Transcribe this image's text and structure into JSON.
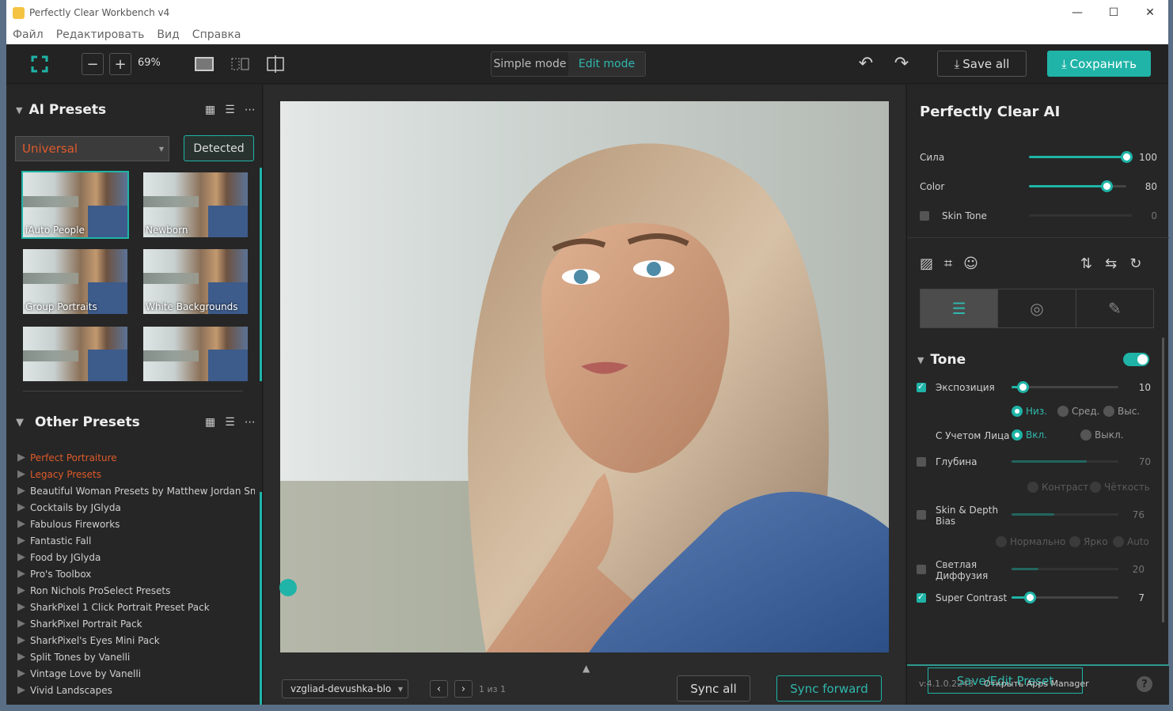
{
  "window": {
    "title": "Perfectly Clear Workbench v4",
    "minimize": "—",
    "maximize": "☐",
    "close": "✕"
  },
  "menu": [
    "Файл",
    "Редактировать",
    "Вид",
    "Справка"
  ],
  "toolbar": {
    "zoom_out": "−",
    "zoom_in": "+",
    "zoom_level": "69%",
    "simple_mode": "Simple mode",
    "edit_mode": "Edit mode",
    "save_all": "Save all",
    "save": "Сохранить",
    "undo_icon": "↶",
    "redo_icon": "↷"
  },
  "ai_presets": {
    "title": "AI Presets",
    "dropdown": "Universal",
    "detected": "Detected",
    "items": [
      "iAuto People",
      "Newborn",
      "Group Portraits",
      "White Backgrounds",
      "",
      ""
    ],
    "selected": "iAuto People"
  },
  "other_presets": {
    "title": "Other Presets",
    "items": [
      "Perfect Portraiture",
      "Legacy Presets",
      "Beautiful Woman Presets by Matthew Jordan Sm...",
      "Cocktails by JGlyda",
      "Fabulous Fireworks",
      "Fantastic Fall",
      "Food by JGlyda",
      "Pro's Toolbox",
      "Ron Nichols ProSelect Presets",
      "SharkPixel 1 Click Portrait Preset Pack",
      "SharkPixel Portrait Pack",
      "SharkPixel's Eyes Mini Pack",
      "Split Tones by Vanelli",
      "Vintage Love by Vanelli",
      "Vivid Landscapes"
    ],
    "highlighted": [
      "Perfect Portraiture",
      "Legacy Presets"
    ]
  },
  "canvas": {
    "filename": "vzgliad-devushka-blo",
    "page_info": "1 из 1",
    "sync_all": "Sync all",
    "sync_forward": "Sync forward"
  },
  "right": {
    "title": "Perfectly Clear AI",
    "strength": {
      "label": "Сила",
      "value": "100",
      "fraction": 1.0
    },
    "color": {
      "label": "Color",
      "value": "80",
      "fraction": 0.8
    },
    "skin_tone": {
      "label": "Skin Tone",
      "value": "0",
      "fraction": 0.0,
      "checked": false
    },
    "tone": {
      "title": "Tone",
      "enabled": true,
      "exposure": {
        "label": "Экспозиция",
        "value": "10",
        "fraction": 0.1,
        "checked": true
      },
      "exposure_levels": [
        "Низ.",
        "Сред.",
        "Выс."
      ],
      "exposure_level_selected": "Низ.",
      "face_aware_label": "С Учетом Лица",
      "face_aware_options": [
        "Вкл.",
        "Выкл."
      ],
      "face_aware_selected": "Вкл.",
      "depth": {
        "label": "Глубина",
        "value": "70",
        "fraction": 0.7,
        "checked": false
      },
      "depth_options": [
        "Контраст",
        "Чёткость"
      ],
      "skin_depth": {
        "label_1": "Skin & Depth",
        "label_2": "Bias",
        "value": "76",
        "fraction": 0.4,
        "checked": false
      },
      "skin_depth_options": [
        "Нормально",
        "Ярко",
        "Auto"
      ],
      "light_diffusion": {
        "label_1": "Светлая",
        "label_2": "Диффузия",
        "value": "20",
        "fraction": 0.25,
        "checked": false
      },
      "super_contrast": {
        "label": "Super Contrast",
        "value": "7",
        "fraction": 0.17,
        "checked": true
      }
    },
    "save_edit_preset": "Save/Edit Preset",
    "version": "v:4.1.0.2243",
    "apps_manager": "Открыть Apps Manager",
    "help": "?"
  },
  "colors": {
    "accent": "#1fb4a7",
    "highlight": "#e05a2b",
    "background": "#232323"
  }
}
